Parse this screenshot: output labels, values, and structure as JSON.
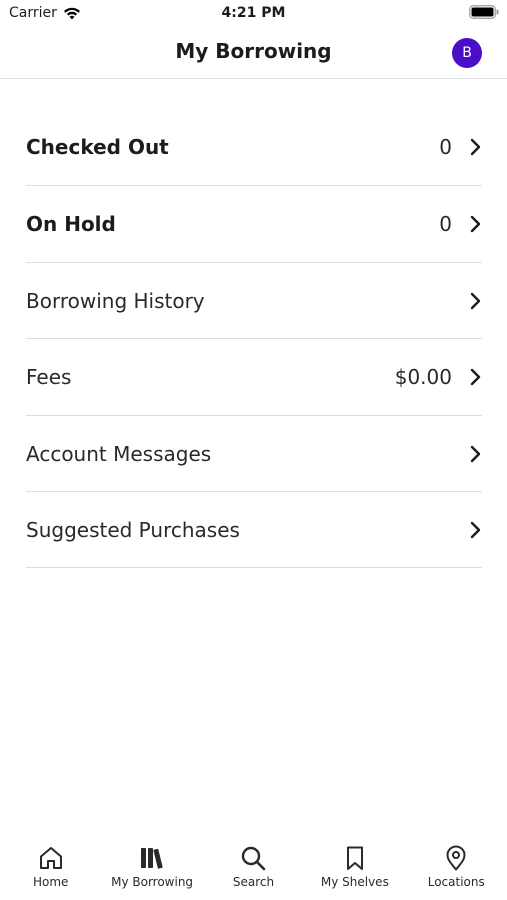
{
  "status_bar": {
    "carrier": "Carrier",
    "time": "4:21 PM"
  },
  "header": {
    "title": "My Borrowing",
    "avatar_initial": "B",
    "avatar_color": "#4b0ec8"
  },
  "menu": {
    "items": [
      {
        "label": "Checked Out",
        "value": "0"
      },
      {
        "label": "On Hold",
        "value": "0"
      },
      {
        "label": "Borrowing History",
        "value": ""
      },
      {
        "label": "Fees",
        "value": "$0.00"
      },
      {
        "label": "Account Messages",
        "value": ""
      },
      {
        "label": "Suggested Purchases",
        "value": ""
      }
    ]
  },
  "tabs": [
    {
      "label": "Home",
      "icon": "home-icon"
    },
    {
      "label": "My Borrowing",
      "icon": "books-icon"
    },
    {
      "label": "Search",
      "icon": "search-icon"
    },
    {
      "label": "My Shelves",
      "icon": "bookmark-icon"
    },
    {
      "label": "Locations",
      "icon": "location-pin-icon"
    }
  ]
}
